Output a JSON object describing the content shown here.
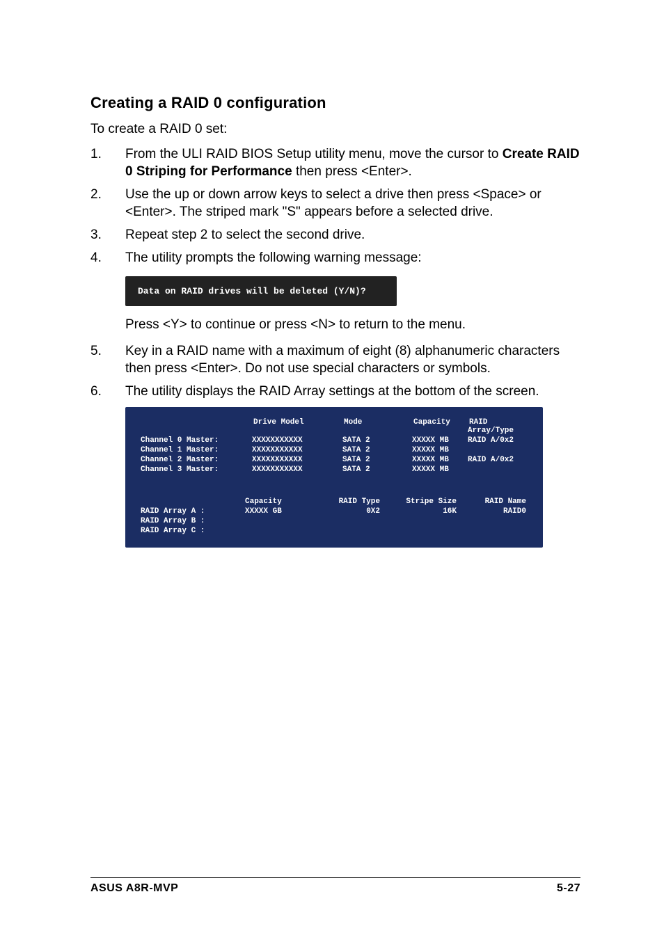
{
  "heading": "Creating a RAID 0 configuration",
  "intro": "To create a RAID 0 set:",
  "steps": [
    {
      "num": "1.",
      "pre": "From the ULI RAID BIOS Setup utility menu, move the cursor to ",
      "bold": "Create RAID 0 Striping for Performance",
      "post": " then press <Enter>."
    },
    {
      "num": "2.",
      "pre": "Use the up or down arrow keys to select a drive then press <Space> or <Enter>. The striped mark \"S\" appears before a selected drive.",
      "bold": "",
      "post": ""
    },
    {
      "num": "3.",
      "pre": "Repeat step 2 to select the second drive.",
      "bold": "",
      "post": ""
    },
    {
      "num": "4.",
      "pre": "The utility prompts the following warning message:",
      "bold": "",
      "post": ""
    }
  ],
  "warning": "Data on RAID drives will be deleted (Y/N)?",
  "after_warning": "Press <Y> to continue or press <N> to return to the menu.",
  "steps2": [
    {
      "num": "5.",
      "pre": "Key in a RAID name with a maximum of eight (8) alphanumeric characters then press <Enter>. Do not use special characters or symbols.",
      "bold": "",
      "post": ""
    },
    {
      "num": "6.",
      "pre": "The utility displays the RAID Array settings at the bottom of the screen.",
      "bold": "",
      "post": ""
    }
  ],
  "bios": {
    "table1": {
      "headers": [
        "",
        "Drive Model",
        "Mode",
        "Capacity",
        "RAID Array/Type"
      ],
      "rows": [
        [
          "Channel 0 Master:",
          "XXXXXXXXXXX",
          "SATA 2",
          "XXXXX MB",
          "RAID A/0x2"
        ],
        [
          "Channel 1 Master:",
          "XXXXXXXXXXX",
          "SATA 2",
          "XXXXX MB",
          ""
        ],
        [
          "Channel 2 Master:",
          "XXXXXXXXXXX",
          "SATA 2",
          "XXXXX MB",
          "RAID A/0x2"
        ],
        [
          "Channel 3 Master:",
          "XXXXXXXXXXX",
          "SATA 2",
          "XXXXX MB",
          ""
        ]
      ]
    },
    "table2": {
      "headers": [
        "",
        "Capacity",
        "RAID Type",
        "Stripe Size",
        "RAID Name"
      ],
      "rows": [
        [
          "RAID Array A   :",
          "XXXXX GB",
          "0X2",
          "16K",
          "RAID0"
        ],
        [
          "RAID Array B   :",
          "",
          "",
          "",
          ""
        ],
        [
          "RAID Array C   :",
          "",
          "",
          "",
          ""
        ]
      ]
    }
  },
  "footer": {
    "left": "ASUS A8R-MVP",
    "right": "5-27"
  }
}
